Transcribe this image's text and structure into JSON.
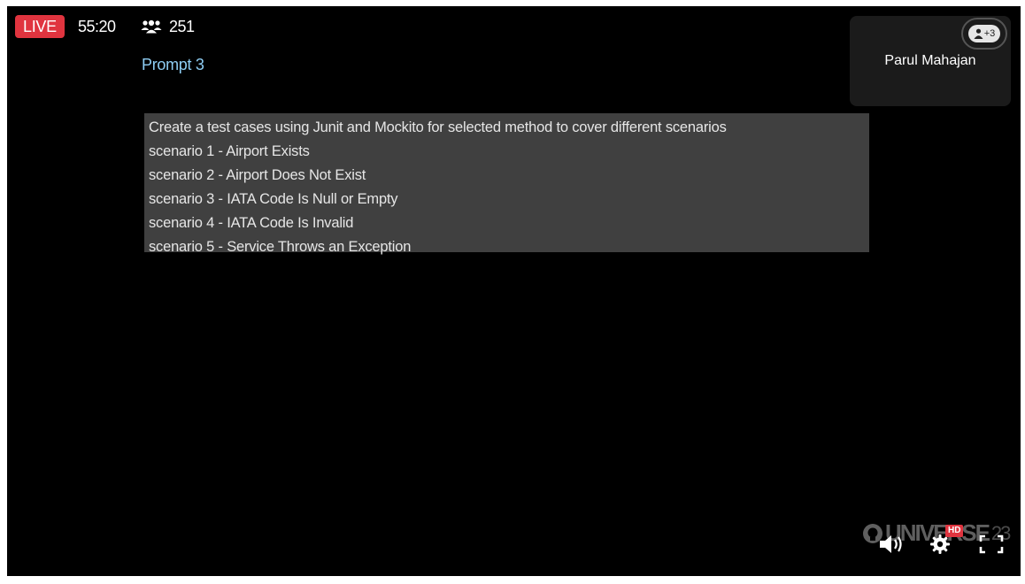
{
  "status": {
    "live_label": "LIVE",
    "elapsed_time": "55:20",
    "viewer_count": "251"
  },
  "prompt": {
    "title": "Prompt 3",
    "lines": [
      "Create a test cases using Junit and Mockito for selected method to cover different scenarios",
      "scenario 1 - Airport Exists",
      "scenario 2 - Airport Does Not Exist",
      "scenario 3 - IATA Code Is Null or Empty",
      "scenario 4 - IATA Code Is Invalid",
      "scenario 5 - Service Throws an Exception"
    ]
  },
  "participant": {
    "name": "Parul Mahajan",
    "more_count": "+3"
  },
  "watermark": {
    "text": "UNIVERSE",
    "suffix": "23"
  },
  "controls": {
    "quality_badge": "HD",
    "icons": [
      "volume-icon",
      "settings-icon",
      "fullscreen-icon"
    ]
  },
  "colors": {
    "live": "#e0343f",
    "prompt_title": "#8ecdf3",
    "text_block_bg": "#404040",
    "player_bg": "#000000"
  }
}
